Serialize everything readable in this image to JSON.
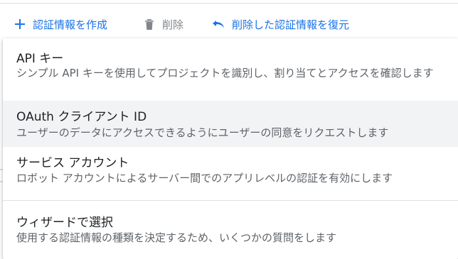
{
  "toolbar": {
    "create_label": "認証情報を作成",
    "delete_label": "削除",
    "restore_label": "削除した認証情報を復元",
    "create_icon": "plus-icon",
    "delete_icon": "trash-icon",
    "restore_icon": "undo-icon"
  },
  "menu": {
    "items": [
      {
        "title": "API キー",
        "description": "シンプル API キーを使用してプロジェクトを識別し、割り当てとアクセスを確認します"
      },
      {
        "title": "OAuth クライアント ID",
        "description": "ユーザーのデータにアクセスできるようにユーザーの同意をリクエストします"
      },
      {
        "title": "サービス アカウント",
        "description": "ロボット アカウントによるサーバー間でのアプリレベルの認証を有効にします"
      },
      {
        "title": "ウィザードで選択",
        "description": "使用する認証情報の種類を決定するため、いくつかの質問をします"
      }
    ]
  },
  "colors": {
    "accent": "#1a73e8",
    "disabled": "#80868b",
    "hover_bg": "#f1f3f4"
  }
}
